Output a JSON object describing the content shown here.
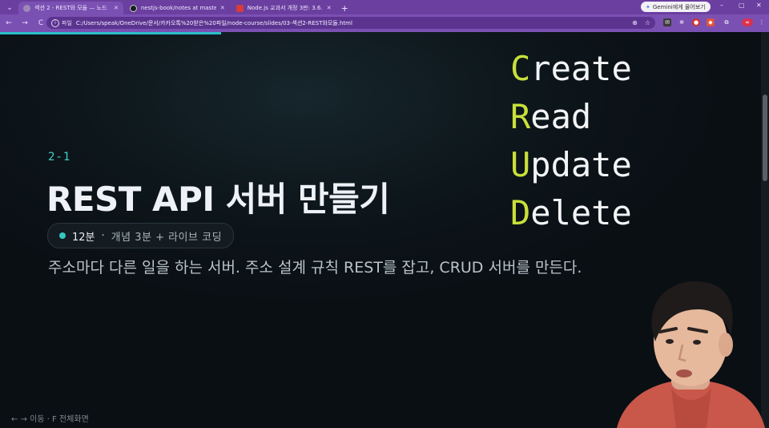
{
  "browser": {
    "tabs": [
      {
        "title": "섹션 2 - REST와 모듈 — 노드",
        "favicon_color": "#9c89b8",
        "active": true
      },
      {
        "title": "nestjs-book/notes at master",
        "favicon_color": "#1b1f24",
        "active": false
      },
      {
        "title": "Node.js 교과서 개정 3판: 3.6.2",
        "favicon_color": "#d93b3b",
        "active": false
      }
    ],
    "new_tab": "+",
    "gemini_button": "Gemini에게 물어보기",
    "window_controls": [
      "–",
      "▢",
      "✕"
    ],
    "nav": {
      "back": "←",
      "forward": "→",
      "reload": "C"
    },
    "omnibox": {
      "chip_label": "파일",
      "url": "C:/Users/speak/OneDrive/문서/카카오톡%20받은%20파일/node-course/slides/03-섹션2-REST와모듈.html"
    },
    "colors": {
      "frame": "#6a3fa0",
      "toolbar": "#7b50b3",
      "accent": "#2bbfc9"
    }
  },
  "slide": {
    "section_number": "2-1",
    "title": "REST API 서버 만들기",
    "meta": {
      "minutes": "12분",
      "separator": "·",
      "breakdown": "개념 3분 + 라이브 코딩"
    },
    "lead": "주소마다 다른 일을 하는 서버. 주소 설계 규칙 REST를 잡고, CRUD 서버를 만든다.",
    "crud": [
      {
        "initial": "C",
        "rest": "reate"
      },
      {
        "initial": "R",
        "rest": "ead"
      },
      {
        "initial": "U",
        "rest": "pdate"
      },
      {
        "initial": "D",
        "rest": "elete"
      }
    ],
    "footer_hint": "← → 이동  ·  F 전체화면",
    "colors": {
      "accent_teal": "#3fd0c9",
      "crud_initial": "#c8e03a",
      "background": "#0b1116"
    }
  }
}
